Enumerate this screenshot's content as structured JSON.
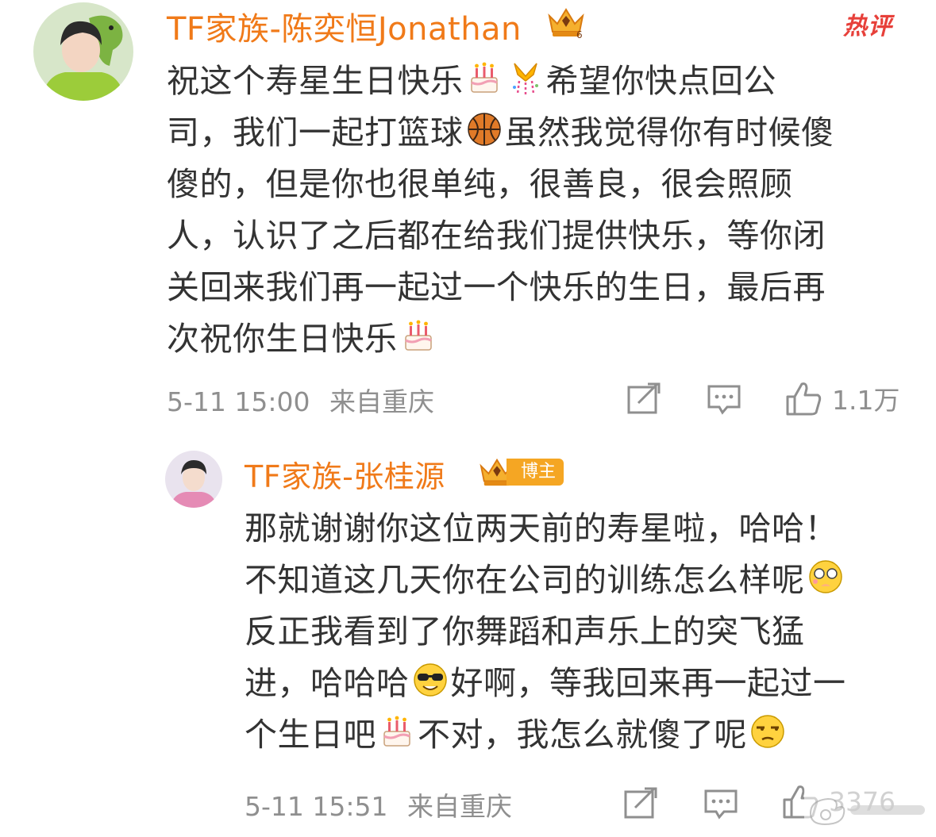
{
  "comments": [
    {
      "username": "TF家族-陈奕恒Jonathan",
      "hot_label": "热评",
      "text_lines": [
        [
          "祝这个寿星生日快乐",
          "{cake}",
          "{gift}",
          "希望你快点回公"
        ],
        [
          "司，我们一起打篮球",
          "{basketball}",
          "虽然我觉得你有时候傻"
        ],
        [
          "傻的，但是你也很单纯，很善良，很会照顾"
        ],
        [
          "人，认识了之后都在给我们提供快乐，等你闭"
        ],
        [
          "关回来我们再一起过一个快乐的生日，最后再"
        ],
        [
          "次祝你生日快乐",
          "{cake}"
        ]
      ],
      "time": "5-11 15:00",
      "location": "来自重庆",
      "likes": "1.1万",
      "avatar_icon": "avatar-boy-dinosaur",
      "icons": [
        "crown-icon",
        "repost-icon",
        "comment-icon",
        "like-icon"
      ]
    },
    {
      "username": "TF家族-张桂源",
      "badge_label": "博主",
      "text_lines": [
        [
          "那就谢谢你这位两天前的寿星啦，哈哈！"
        ],
        [
          "不知道这几天你在公司的训练怎么样呢",
          "{shy}"
        ],
        [
          "反正我看到了你舞蹈和声乐上的突飞猛"
        ],
        [
          "进，哈哈哈",
          "{cool}",
          "好啊，等我回来再一起过一"
        ],
        [
          "个生日吧",
          "{cake}",
          "不对，我怎么就傻了呢",
          "{unamused}"
        ]
      ],
      "time": "5-11 15:51",
      "location": "来自重庆",
      "likes": "3376",
      "avatar_icon": "avatar-boy-pink",
      "icons": [
        "crown-icon",
        "repost-icon",
        "comment-icon",
        "like-icon"
      ]
    }
  ],
  "watermark_icon": "weibo-watermark-icon",
  "colors": {
    "username": "#f07a19",
    "hot": "#e7403a",
    "meta": "#8f8f8f",
    "text": "#333333",
    "badge": "#f5a623"
  }
}
